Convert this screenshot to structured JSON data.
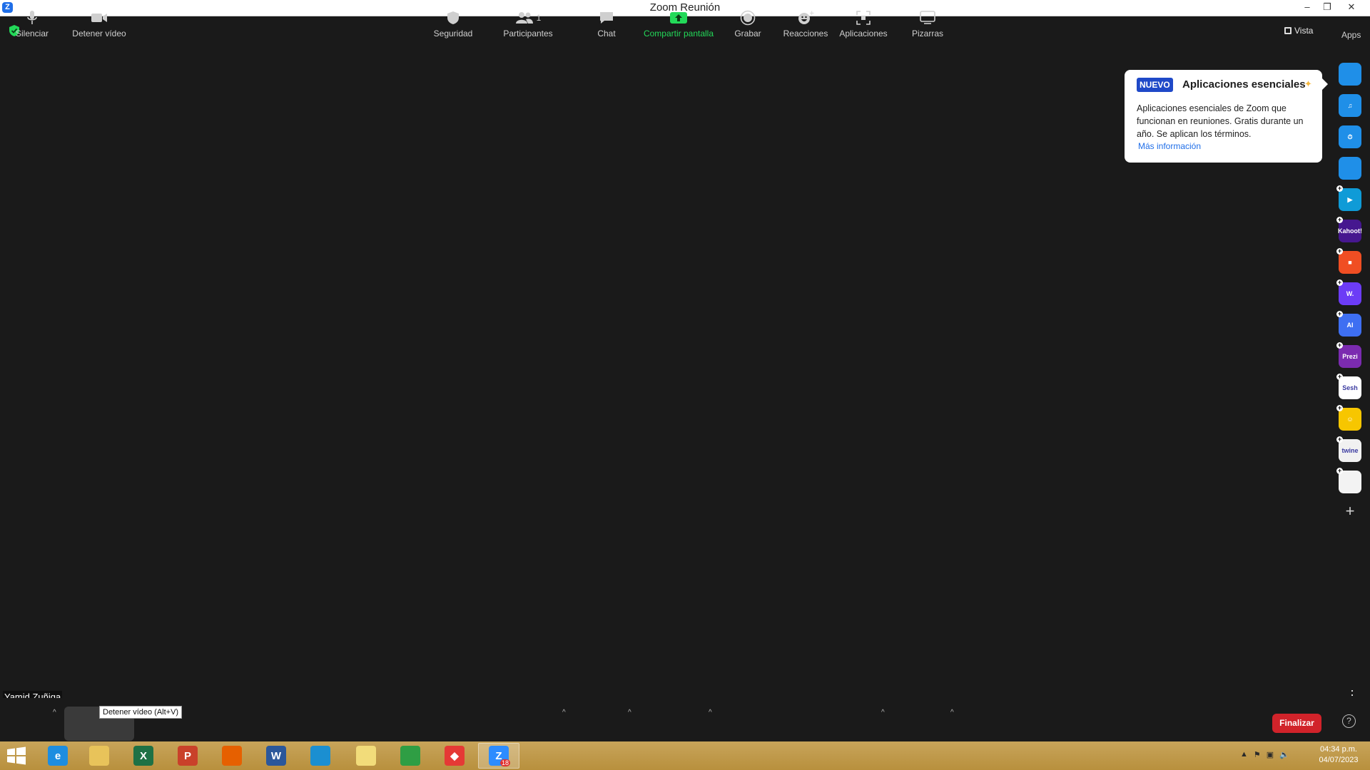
{
  "window": {
    "title": "Zoom Reunión",
    "logo_letter": "Z",
    "minimize": "–",
    "restore": "❐",
    "close": "✕"
  },
  "top_right": {
    "vista_label": "Vista",
    "apps_label": "Apps"
  },
  "popup": {
    "badge": "NUEVO",
    "title": "Aplicaciones esenciales",
    "body": "Aplicaciones esenciales de Zoom que funcionan en reuniones. Gratis durante un año. Se aplican los términos.",
    "link": "Más información"
  },
  "apps": [
    {
      "name": "camera-app-icon",
      "color": "#1f8fe8",
      "text": ""
    },
    {
      "name": "music-app-icon",
      "color": "#1f8fe8",
      "text": "♫"
    },
    {
      "name": "timer-app-icon",
      "color": "#1f8fe8",
      "text": "⏱"
    },
    {
      "name": "profile-app-icon",
      "color": "#1f8fe8",
      "text": ""
    },
    {
      "name": "flow-app-icon",
      "color": "#0f9bd7",
      "text": "▶"
    },
    {
      "name": "kahoot-app-icon",
      "color": "#46178f",
      "text": "Kahoot!"
    },
    {
      "name": "red-app-icon",
      "color": "#f04e23",
      "text": "■"
    },
    {
      "name": "wooclap-app-icon",
      "color": "#6c3cf6",
      "text": "W."
    },
    {
      "name": "ai-app-icon",
      "color": "#3e6ff2",
      "text": "AI"
    },
    {
      "name": "prezi-app-icon",
      "color": "#7b2bb0",
      "text": "Prezi"
    },
    {
      "name": "sesh-app-icon",
      "color": "#ffffff",
      "text": "Sesh"
    },
    {
      "name": "emoji-app-icon",
      "color": "#f7c600",
      "text": "☺"
    },
    {
      "name": "twine-app-icon",
      "color": "#f1f1f1",
      "text": "twine"
    },
    {
      "name": "grid-app-icon",
      "color": "#f3f3f3",
      "text": ""
    }
  ],
  "participant_name": "Yamid Zuñiga",
  "toolbar": {
    "mute": "Silenciar",
    "video": "Detener vídeo",
    "video_tooltip": "Detener vídeo (Alt+V)",
    "security": "Seguridad",
    "participants": "Participantes",
    "participants_count": "1",
    "chat": "Chat",
    "share": "Compartir pantalla",
    "record": "Grabar",
    "reactions": "Reacciones",
    "apps": "Aplicaciones",
    "whiteboards": "Pizarras",
    "end": "Finalizar",
    "help": "?"
  },
  "taskbar": {
    "apps": [
      {
        "name": "internet-explorer-icon",
        "color": "#1d8de0",
        "letter": "e"
      },
      {
        "name": "file-explorer-icon",
        "color": "#e8c35a",
        "letter": ""
      },
      {
        "name": "excel-icon",
        "color": "#1e7145",
        "letter": "X"
      },
      {
        "name": "powerpoint-icon",
        "color": "#c9412a",
        "letter": "P"
      },
      {
        "name": "firefox-icon",
        "color": "#e66000",
        "letter": ""
      },
      {
        "name": "word-icon",
        "color": "#2b579a",
        "letter": "W"
      },
      {
        "name": "edge-icon",
        "color": "#1b8fd1",
        "letter": ""
      },
      {
        "name": "sticky-notes-icon",
        "color": "#f2dc7a",
        "letter": ""
      },
      {
        "name": "chrome-icon",
        "color": "#2f9e44",
        "letter": ""
      },
      {
        "name": "anydesk-icon",
        "color": "#e53935",
        "letter": "◆"
      },
      {
        "name": "zoom-icon",
        "color": "#2d8cff",
        "letter": "Z",
        "badge": "18"
      }
    ],
    "time": "04:34 p.m.",
    "date": "04/07/2023"
  }
}
